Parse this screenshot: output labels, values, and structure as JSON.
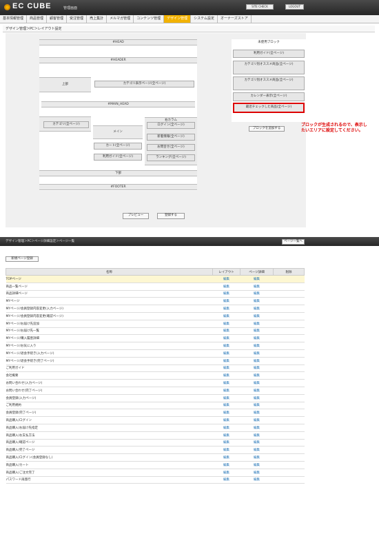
{
  "header": {
    "logo_text": "EC CUBE",
    "logo_sub": "管理画面",
    "site_check": "SITE CHECK",
    "logout": "LOGOUT"
  },
  "nav": [
    {
      "label": "基本情報管理",
      "active": false
    },
    {
      "label": "商品管理",
      "active": false
    },
    {
      "label": "顧客管理",
      "active": false
    },
    {
      "label": "受注管理",
      "active": false
    },
    {
      "label": "売上集計",
      "active": false
    },
    {
      "label": "メルマガ管理",
      "active": false
    },
    {
      "label": "コンテンツ管理",
      "active": false
    },
    {
      "label": "デザイン管理",
      "active": true
    },
    {
      "label": "システム設定",
      "active": false
    },
    {
      "label": "オーナーズストア",
      "active": false
    }
  ],
  "breadcrumb": "デザイン管理＞PC＞レイアウト設定",
  "layout": {
    "head": "#HEAD",
    "header": "#HEADER",
    "top_label": "上部",
    "top_block": "カテゴリ表示ページ(全ページ)",
    "left_col": "左カラム",
    "left_block": "カテゴリ(全ページ)",
    "main_head": "#MAIN_HEAD",
    "main_label": "メイン",
    "main_block1": "カート(全ページ)",
    "main_block2": "利用ガイド(全ページ)",
    "main_block3": "お問合せ(全ページ)",
    "right_col": "右カラム",
    "right_block1": "ログイン(全ページ)",
    "right_block2": "新着情報(全ページ)",
    "right_block3": "ランキング(全ページ)",
    "bottom_label": "下部",
    "footer": "#FOOTER"
  },
  "unused": {
    "title": "未使用ブロック",
    "blocks": [
      "利用ガイド(全ページ)",
      "カテゴリ別オススメ商品(全ページ)",
      "カテゴリ別オススメ商品(全ページ)",
      "カレンダー表示(全ページ)",
      "最近チェックした商品(全ページ)"
    ]
  },
  "callout": "ブロックが生成されるので、表示したいエリアに設定してください。",
  "new_block_button": "ブロックを追加する",
  "preview_button": "プレビュー",
  "register_button": "登録する",
  "section2": {
    "title": "デザイン管理＞PC＞ページ詳細設定＞ページ一覧",
    "new_page_button": "新規ページ登録",
    "right_button": "ページ一覧へ",
    "columns": [
      "名称",
      "レイアウト",
      "ページ詳細",
      "削除"
    ],
    "edit": "編集",
    "rows": [
      "TOPページ",
      "商品一覧ページ",
      "商品詳細ページ",
      "MYページ",
      "MYページ/会員登録内容変更(入力ページ)",
      "MYページ/会員登録内容変更(確認ページ)",
      "MYページ/お届け先追加",
      "MYページ/お届け先一覧",
      "MYページ/購入履歴詳細",
      "MYページ/お気に入り",
      "MYページ/退会手続き(入力ページ)",
      "MYページ/退会手続き(完了ページ)",
      "ご利用ガイド",
      "会社概要",
      "お問い合わせ(入力ページ)",
      "お問い合わせ(完了ページ)",
      "会員登録(入力ページ)",
      "ご利用規約",
      "会員登録(完了ページ)",
      "商品購入/ログイン",
      "商品購入/お届け先指定",
      "商品購入/お支払方法",
      "商品購入/確認ページ",
      "商品購入/完了ページ",
      "商品購入/ログイン(会員登録なし)",
      "商品購入/カート",
      "商品購入/ご注文完了",
      "パスワード再発行"
    ]
  }
}
